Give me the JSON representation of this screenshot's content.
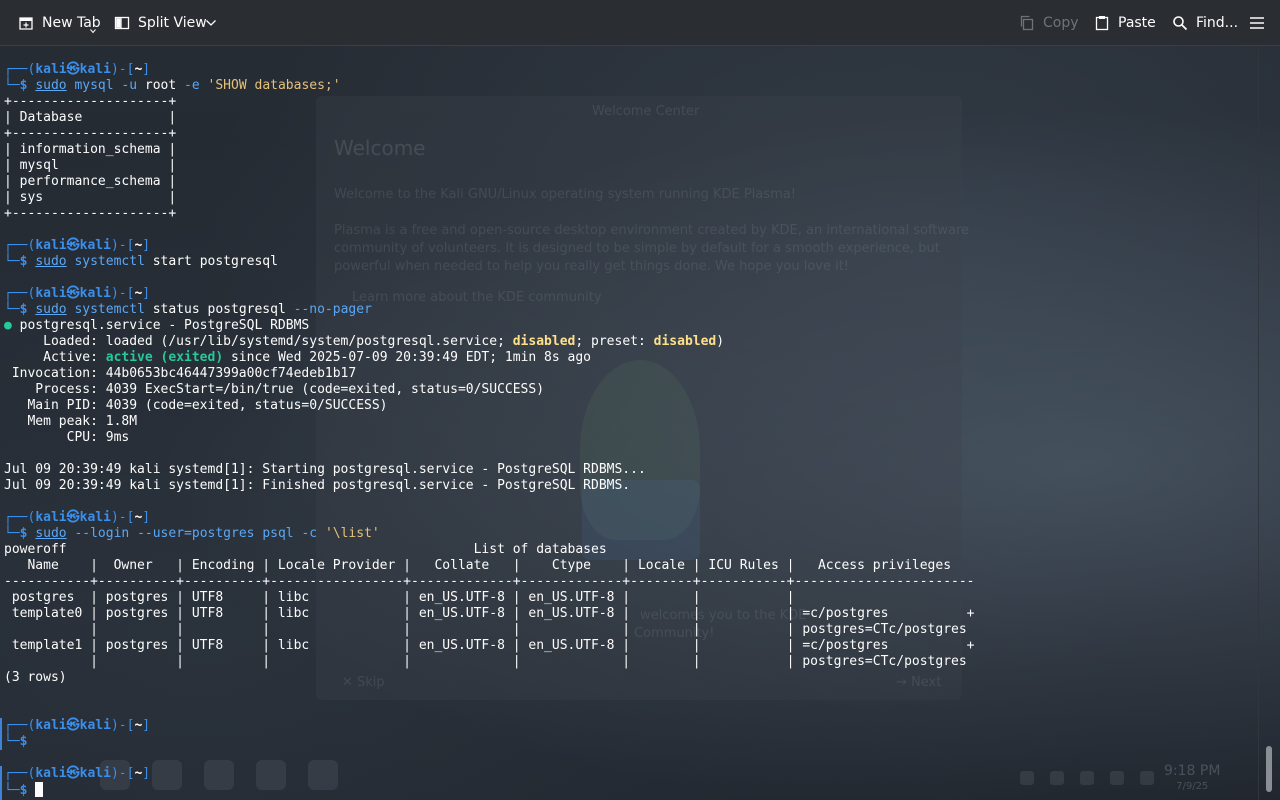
{
  "toolbar": {
    "new_tab": "New Tab",
    "split_view": "Split View",
    "copy": "Copy",
    "paste": "Paste",
    "find": "Find..."
  },
  "background": {
    "welcome_title": "Welcome",
    "welcome_window_title": "Welcome Center",
    "welcome_line1": "Welcome to the Kali GNU/Linux operating system running KDE Plasma!",
    "welcome_line2": "Plasma is a free and open-source desktop environment created by KDE, an international software",
    "welcome_line3": "community of volunteers. It is designed to be simple by default for a smooth experience, but",
    "welcome_line4": "powerful when needed to help you really get things done. We hope you love it!",
    "welcome_link": "Learn more about the KDE community",
    "community_text": "welcomes you to the KDE",
    "community_text2": "Community!",
    "skip": "✕ Skip",
    "next": "→ Next",
    "clock_time": "9:18 PM",
    "clock_date": "7/9/25"
  },
  "terminal": {
    "prompt_user": "kali",
    "prompt_host": "kali",
    "prompt_dir": "~",
    "lines": {
      "cmd1": "sudo mysql -u root -e 'SHOW databases;'",
      "border": "+--------------------+",
      "db_header": "| Database           |",
      "db1": "| information_schema |",
      "db2": "| mysql              |",
      "db3": "| performance_schema |",
      "db4": "| sys                |",
      "cmd2": "sudo systemctl start postgresql",
      "cmd3": "sudo systemctl status postgresql --no-pager",
      "svc_name": "postgresql.service - PostgreSQL RDBMS",
      "loaded_pre": "     Loaded: loaded (/usr/lib/systemd/system/postgresql.service; ",
      "loaded_disabled1": "disabled",
      "loaded_mid": "; preset: ",
      "loaded_disabled2": "disabled",
      "loaded_end": ")",
      "active_pre": "     Active: ",
      "active_state": "active (exited)",
      "active_post": " since Wed 2025-07-09 20:39:49 EDT; 1min 8s ago",
      "invocation": " Invocation: 44b0653bc46447399a00cf74edeb1b17",
      "process": "    Process: 4039 ExecStart=/bin/true (code=exited, status=0/SUCCESS)",
      "mainpid": "   Main PID: 4039 (code=exited, status=0/SUCCESS)",
      "mempeak": "   Mem peak: 1.8M",
      "cpu": "        CPU: 9ms",
      "log1": "Jul 09 20:39:49 kali systemd[1]: Starting postgresql.service - PostgreSQL RDBMS...",
      "log2": "Jul 09 20:39:49 kali systemd[1]: Finished postgresql.service - PostgreSQL RDBMS.",
      "cmd4": "sudo --login --user=postgres psql -c '\\list'",
      "poweroff": "poweroff",
      "list_title": "                                                            List of databases",
      "list_header": "   Name    |  Owner   | Encoding | Locale Provider |   Collate   |    Ctype    | Locale | ICU Rules |   Access privileges",
      "list_sep": "-----------+----------+----------+-----------------+-------------+-------------+--------+-----------+-----------------------",
      "row1": " postgres  | postgres | UTF8     | libc            | en_US.UTF-8 | en_US.UTF-8 |        |           |",
      "row2": " template0 | postgres | UTF8     | libc            | en_US.UTF-8 | en_US.UTF-8 |        |           | =c/postgres          +",
      "row2b": "           |          |          |                 |             |             |        |           | postgres=CTc/postgres",
      "row3": " template1 | postgres | UTF8     | libc            | en_US.UTF-8 | en_US.UTF-8 |        |           | =c/postgres          +",
      "row3b": "           |          |          |                 |             |             |        |           | postgres=CTc/postgres",
      "rows": "(3 rows)"
    }
  }
}
